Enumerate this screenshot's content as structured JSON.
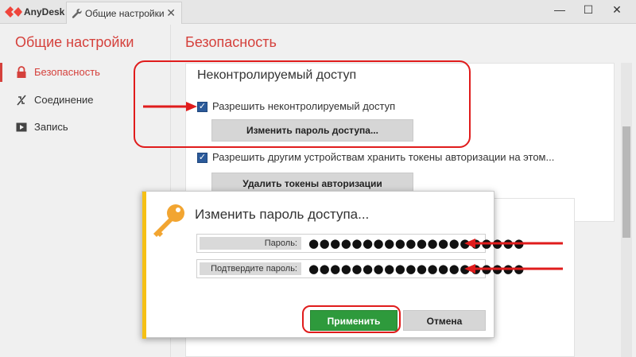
{
  "titlebar": {
    "app_name": "AnyDesk",
    "tab_label": "Общие настройки",
    "tab_close": "✕",
    "minimize": "—",
    "maximize": "☐",
    "close": "✕"
  },
  "sidebar": {
    "title": "Общие настройки",
    "items": [
      {
        "label": "Безопасность",
        "icon": "lock-icon",
        "active": true
      },
      {
        "label": "Соединение",
        "icon": "connection-icon",
        "active": false
      },
      {
        "label": "Запись",
        "icon": "record-icon",
        "active": false
      }
    ]
  },
  "main": {
    "title": "Безопасность",
    "section_title": "Неконтролируемый доступ",
    "allow_unattended": {
      "label": "Разрешить неконтролируемый доступ",
      "checked": true
    },
    "change_password_button": "Изменить пароль доступа...",
    "allow_tokens": {
      "label": "Разрешить другим устройствам хранить токены авторизации на этом...",
      "checked": true
    },
    "delete_tokens_button": "Удалить токены авторизации"
  },
  "dialog": {
    "title": "Изменить пароль доступа...",
    "password_label": "Пароль:",
    "password_value": "●●●●●●●●●●●●●●●●●●●●",
    "confirm_label": "Подтвердите пароль:",
    "confirm_value": "●●●●●●●●●●●●●●●●●●●●",
    "apply_button": "Применить",
    "cancel_button": "Отмена"
  },
  "colors": {
    "accent": "#d5413c",
    "highlight": "#e01c1c",
    "apply": "#2e9a3c",
    "dialog_bar": "#f5c016",
    "checkbox": "#2b5a9a"
  }
}
